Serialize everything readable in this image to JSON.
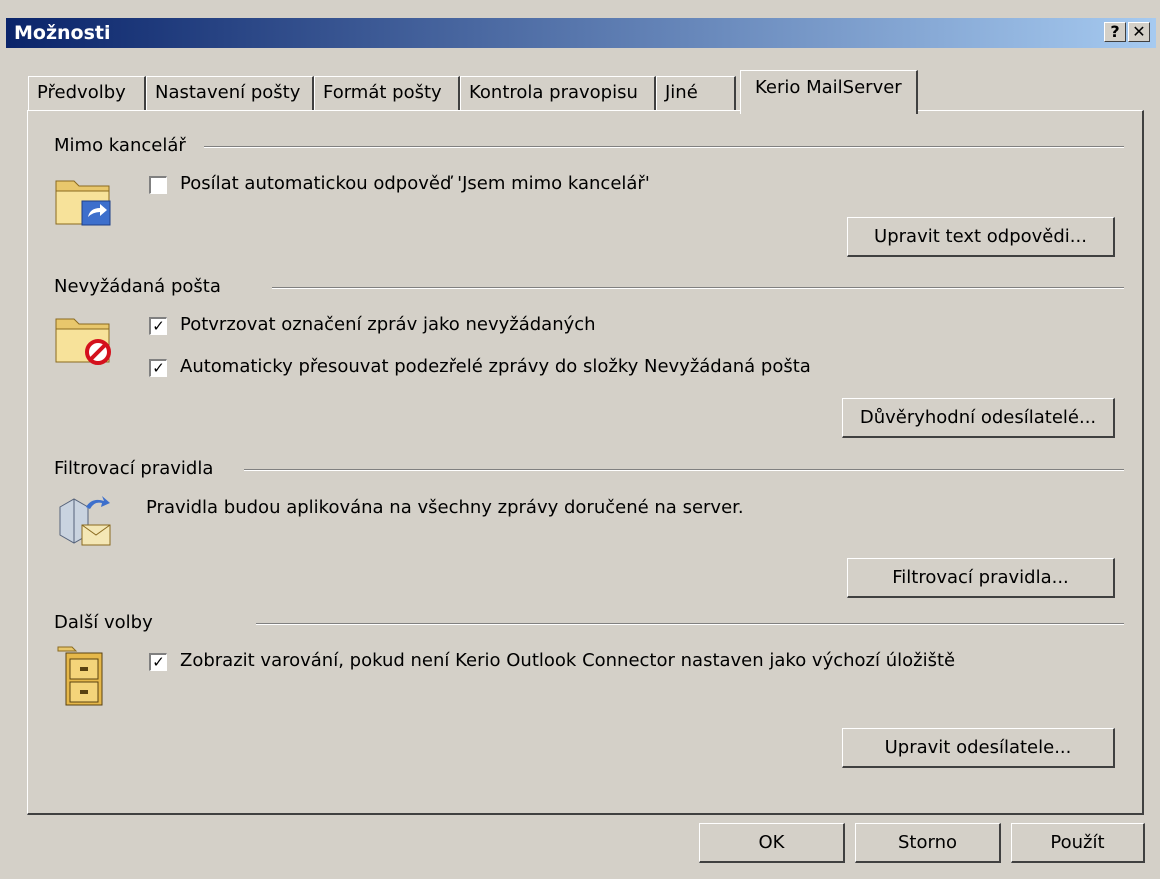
{
  "window": {
    "title": "Možnosti",
    "help_glyph": "?",
    "close_glyph": "✕"
  },
  "tabs": [
    {
      "label": "Předvolby"
    },
    {
      "label": "Nastavení pošty"
    },
    {
      "label": "Formát pošty"
    },
    {
      "label": "Kontrola pravopisu"
    },
    {
      "label": "Jiné"
    },
    {
      "label": "Kerio MailServer",
      "active": true
    }
  ],
  "sections": {
    "out_of_office": {
      "title": "Mimo kancelář",
      "icon": "folder-forward-icon",
      "checkbox_label": "Posílat automatickou odpověď 'Jsem mimo kancelář'",
      "checked": false,
      "button_label": "Upravit text odpovědi..."
    },
    "junk_mail": {
      "title": "Nevyžádaná pošta",
      "icon": "folder-blocked-icon",
      "checkbox1_label": "Potvrzovat označení zpráv jako nevyžádaných",
      "checkbox1_checked": true,
      "checkbox2_label": "Automaticky přesouvat podezřelé zprávy do složky Nevyžádaná pošta",
      "checkbox2_checked": true,
      "button_label": "Důvěryhodní odesílatelé..."
    },
    "filter_rules": {
      "title": "Filtrovací pravidla",
      "icon": "mail-rules-icon",
      "description": "Pravidla budou aplikována na všechny zprávy doručené na server.",
      "button_label": "Filtrovací pravidla..."
    },
    "other": {
      "title": "Další volby",
      "icon": "file-cabinet-icon",
      "checkbox_label": "Zobrazit varování, pokud není Kerio Outlook Connector nastaven jako výchozí úložiště",
      "checked": true,
      "button_label": "Upravit odesílatele..."
    }
  },
  "footer": {
    "ok": "OK",
    "cancel": "Storno",
    "apply": "Použít"
  },
  "colors": {
    "face": "#d4d0c8",
    "title_start": "#0a246a",
    "title_end": "#a6caf0"
  }
}
